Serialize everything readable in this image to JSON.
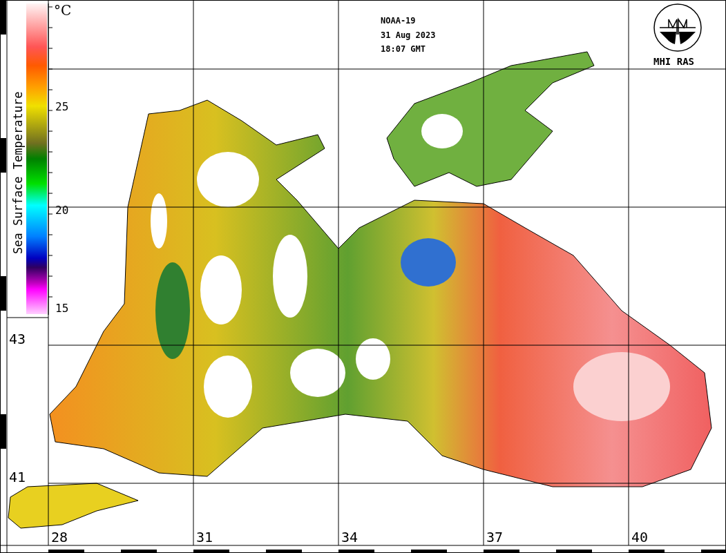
{
  "header": {
    "satellite": "NOAA-19",
    "date": "31 Aug 2023",
    "time": "18:07 GMT"
  },
  "logo": {
    "label": "MHI RAS"
  },
  "legend": {
    "title": "Sea Surface Temperature",
    "unit": "°C",
    "ticks": [
      "25",
      "20",
      "15"
    ]
  },
  "latitude_labels": [
    "43",
    "41"
  ],
  "longitude_labels": [
    "28",
    "31",
    "34",
    "37",
    "40"
  ]
}
